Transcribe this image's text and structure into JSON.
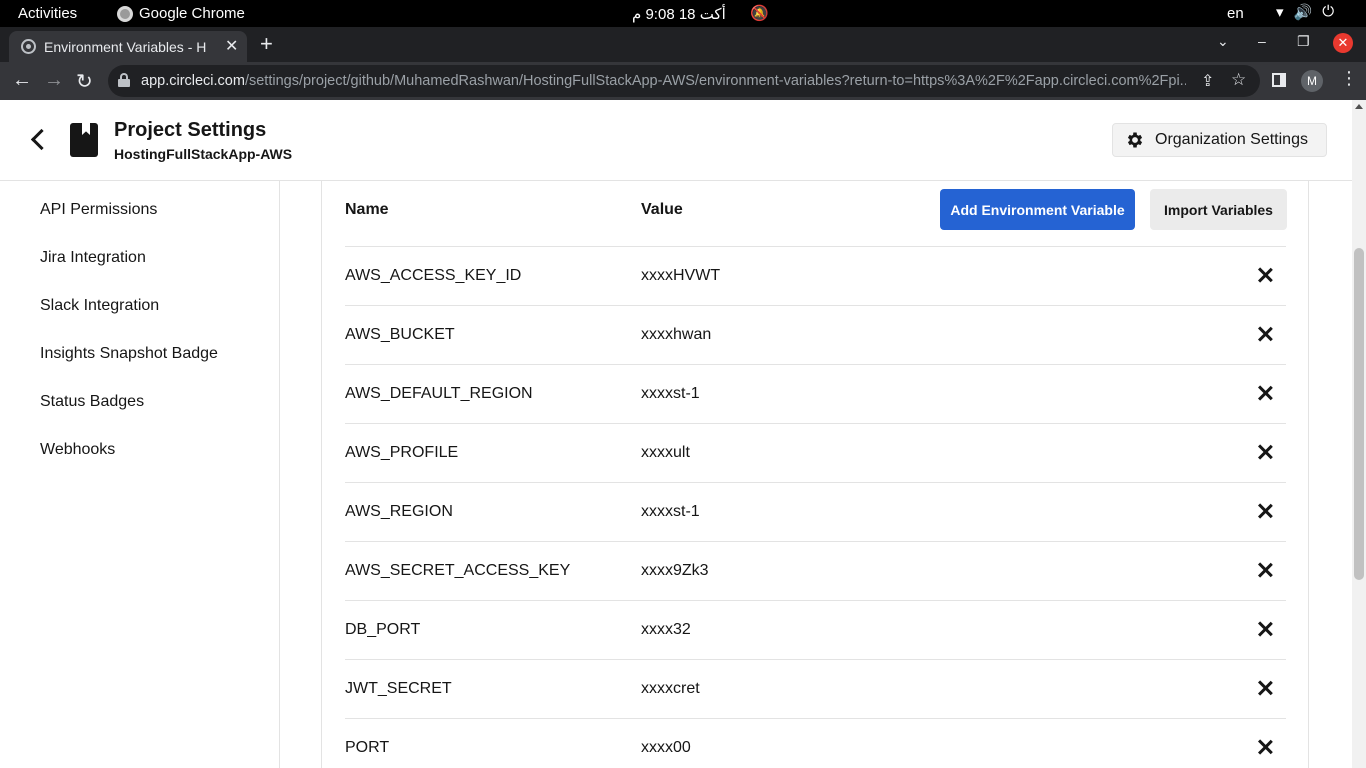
{
  "os_bar": {
    "activities": "Activities",
    "app_name": "Google Chrome",
    "clock": "أكت 18  9:08 م",
    "lang": "en"
  },
  "browser": {
    "tab_title": "Environment Variables - H",
    "url_host": "app.circleci.com",
    "url_path": "/settings/project/github/MuhamedRashwan/HostingFullStackApp-AWS/environment-variables?return-to=https%3A%2F%2Fapp.circleci.com%2Fpi...",
    "profile_initial": "M"
  },
  "header": {
    "title": "Project Settings",
    "subtitle": "HostingFullStackApp-AWS",
    "org_settings": "Organization Settings"
  },
  "sidebar": {
    "items": [
      {
        "label": "API Permissions"
      },
      {
        "label": "Jira Integration"
      },
      {
        "label": "Slack Integration"
      },
      {
        "label": "Insights Snapshot Badge"
      },
      {
        "label": "Status Badges"
      },
      {
        "label": "Webhooks"
      }
    ]
  },
  "env": {
    "col_name": "Name",
    "col_value": "Value",
    "add_button": "Add Environment Variable",
    "import_button": "Import Variables",
    "rows": [
      {
        "name": "AWS_ACCESS_KEY_ID",
        "value": "xxxxHVWT"
      },
      {
        "name": "AWS_BUCKET",
        "value": "xxxxhwan"
      },
      {
        "name": "AWS_DEFAULT_REGION",
        "value": "xxxxst-1"
      },
      {
        "name": "AWS_PROFILE",
        "value": "xxxxult"
      },
      {
        "name": "AWS_REGION",
        "value": "xxxxst-1"
      },
      {
        "name": "AWS_SECRET_ACCESS_KEY",
        "value": "xxxx9Zk3"
      },
      {
        "name": "DB_PORT",
        "value": "xxxx32"
      },
      {
        "name": "JWT_SECRET",
        "value": "xxxxcret"
      },
      {
        "name": "PORT",
        "value": "xxxx00"
      }
    ]
  },
  "colors": {
    "primary_button": "#2563d3",
    "secondary_button": "#ebebeb",
    "browser_chrome": "#35363a",
    "close_red": "#e9392f"
  }
}
